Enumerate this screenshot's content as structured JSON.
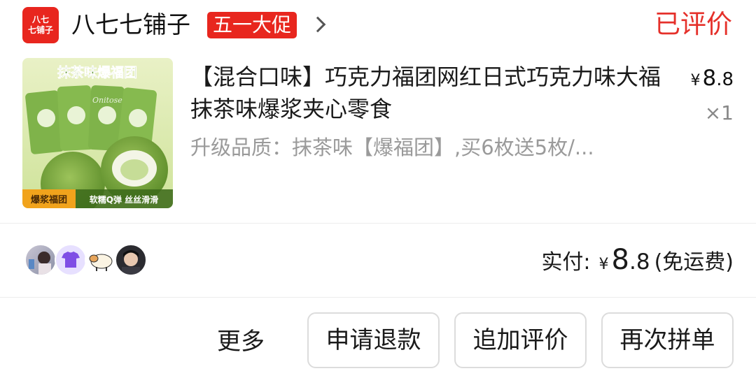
{
  "shop": {
    "logo_text_line1": "八七",
    "logo_text_line2": "七铺子",
    "name": "八七七铺子",
    "promo_badge": "五一大促",
    "order_status": "已评价"
  },
  "product": {
    "image_text_top": "抹茶味爆福团",
    "image_text_bottom_left": "爆浆福团",
    "image_text_bottom_right": "软糯Q弹 丝丝滑滑",
    "image_package_text": "Onitose",
    "title": "【混合口味】巧克力福团网红日式巧克力味大福抹茶味爆浆夹心零食",
    "sku": "升级品质：抹茶味【爆福团】,买6枚送5枚/...",
    "currency": "¥",
    "price_int": "8",
    "price_dec": ".8",
    "quantity": "×1"
  },
  "payment": {
    "label": "实付:",
    "currency": "¥",
    "amount_int": "8",
    "amount_dec": ".8",
    "note": "(免运费)"
  },
  "group_avatars": [
    "avatar-1",
    "avatar-2",
    "avatar-3",
    "avatar-4"
  ],
  "actions": {
    "more": "更多",
    "refund": "申请退款",
    "add_review": "追加评价",
    "rebuy": "再次拼单"
  },
  "colors": {
    "brand_red": "#e8261e",
    "status_red": "#e5302a",
    "matcha_green": "#7fb34a"
  }
}
